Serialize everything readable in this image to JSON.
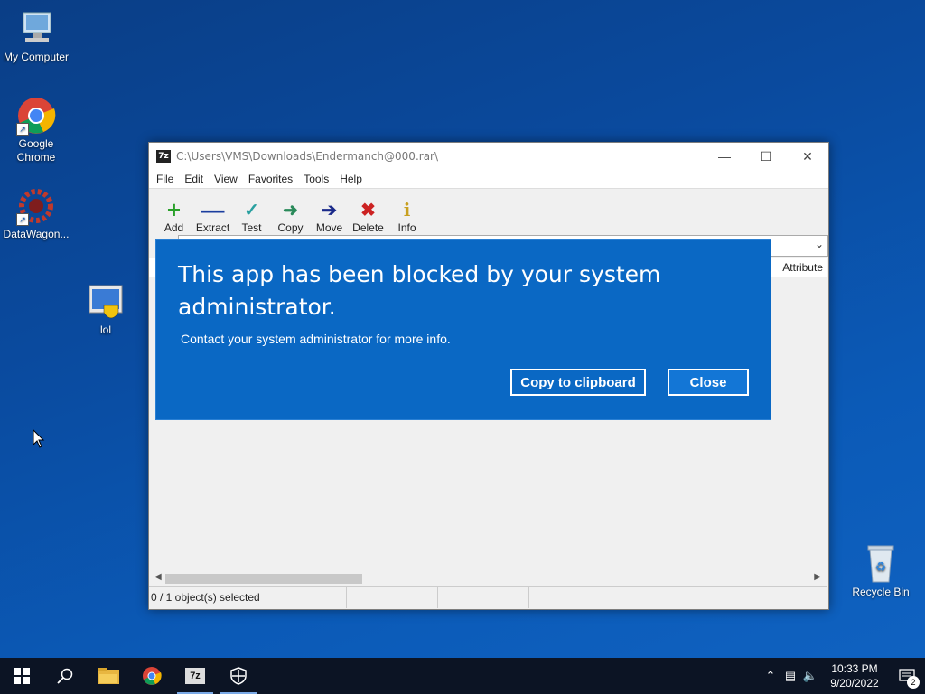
{
  "desktop": {
    "icons": [
      {
        "label": "My Computer"
      },
      {
        "label": "Google Chrome"
      },
      {
        "label": "DataWagon..."
      },
      {
        "label": "lol"
      },
      {
        "label": "Recycle Bin"
      }
    ]
  },
  "window": {
    "title": "C:\\Users\\VMS\\Downloads\\Endermanch@000.rar\\",
    "app_icon": "7z",
    "menu": [
      "File",
      "Edit",
      "View",
      "Favorites",
      "Tools",
      "Help"
    ],
    "toolbar": [
      {
        "label": "Add",
        "icon": "plus-icon",
        "color": "#2aa02a"
      },
      {
        "label": "Extract",
        "icon": "minus-icon",
        "color": "#1a3d9e"
      },
      {
        "label": "Test",
        "icon": "check-icon",
        "color": "#2aa0a0"
      },
      {
        "label": "Copy",
        "icon": "double-arrow-icon",
        "color": "#2a8a5a"
      },
      {
        "label": "Move",
        "icon": "arrow-right-icon",
        "color": "#1a2a8a"
      },
      {
        "label": "Delete",
        "icon": "x-icon",
        "color": "#cc2222"
      },
      {
        "label": "Info",
        "icon": "info-icon",
        "color": "#c8a020"
      }
    ],
    "column_attributes": "Attribute",
    "status": {
      "selected": "0 / 1 object(s) selected"
    }
  },
  "blocked_dialog": {
    "heading": "This app has been blocked by your system administrator.",
    "message": "Contact your system administrator for more info.",
    "copy_button": "Copy to clipboard",
    "close_button": "Close"
  },
  "taskbar": {
    "time": "10:33 PM",
    "date": "9/20/2022",
    "notification_count": "2",
    "pinned": [
      {
        "name": "start",
        "icon": "windows-icon"
      },
      {
        "name": "search",
        "icon": "search-icon"
      },
      {
        "name": "file-explorer",
        "icon": "folder-icon"
      },
      {
        "name": "chrome",
        "icon": "chrome-icon"
      },
      {
        "name": "7zip",
        "icon": "7z-icon"
      },
      {
        "name": "security",
        "icon": "shield-icon"
      }
    ]
  },
  "colors": {
    "dialog_blue": "#0a68c4",
    "taskbar": "#0c1424"
  }
}
